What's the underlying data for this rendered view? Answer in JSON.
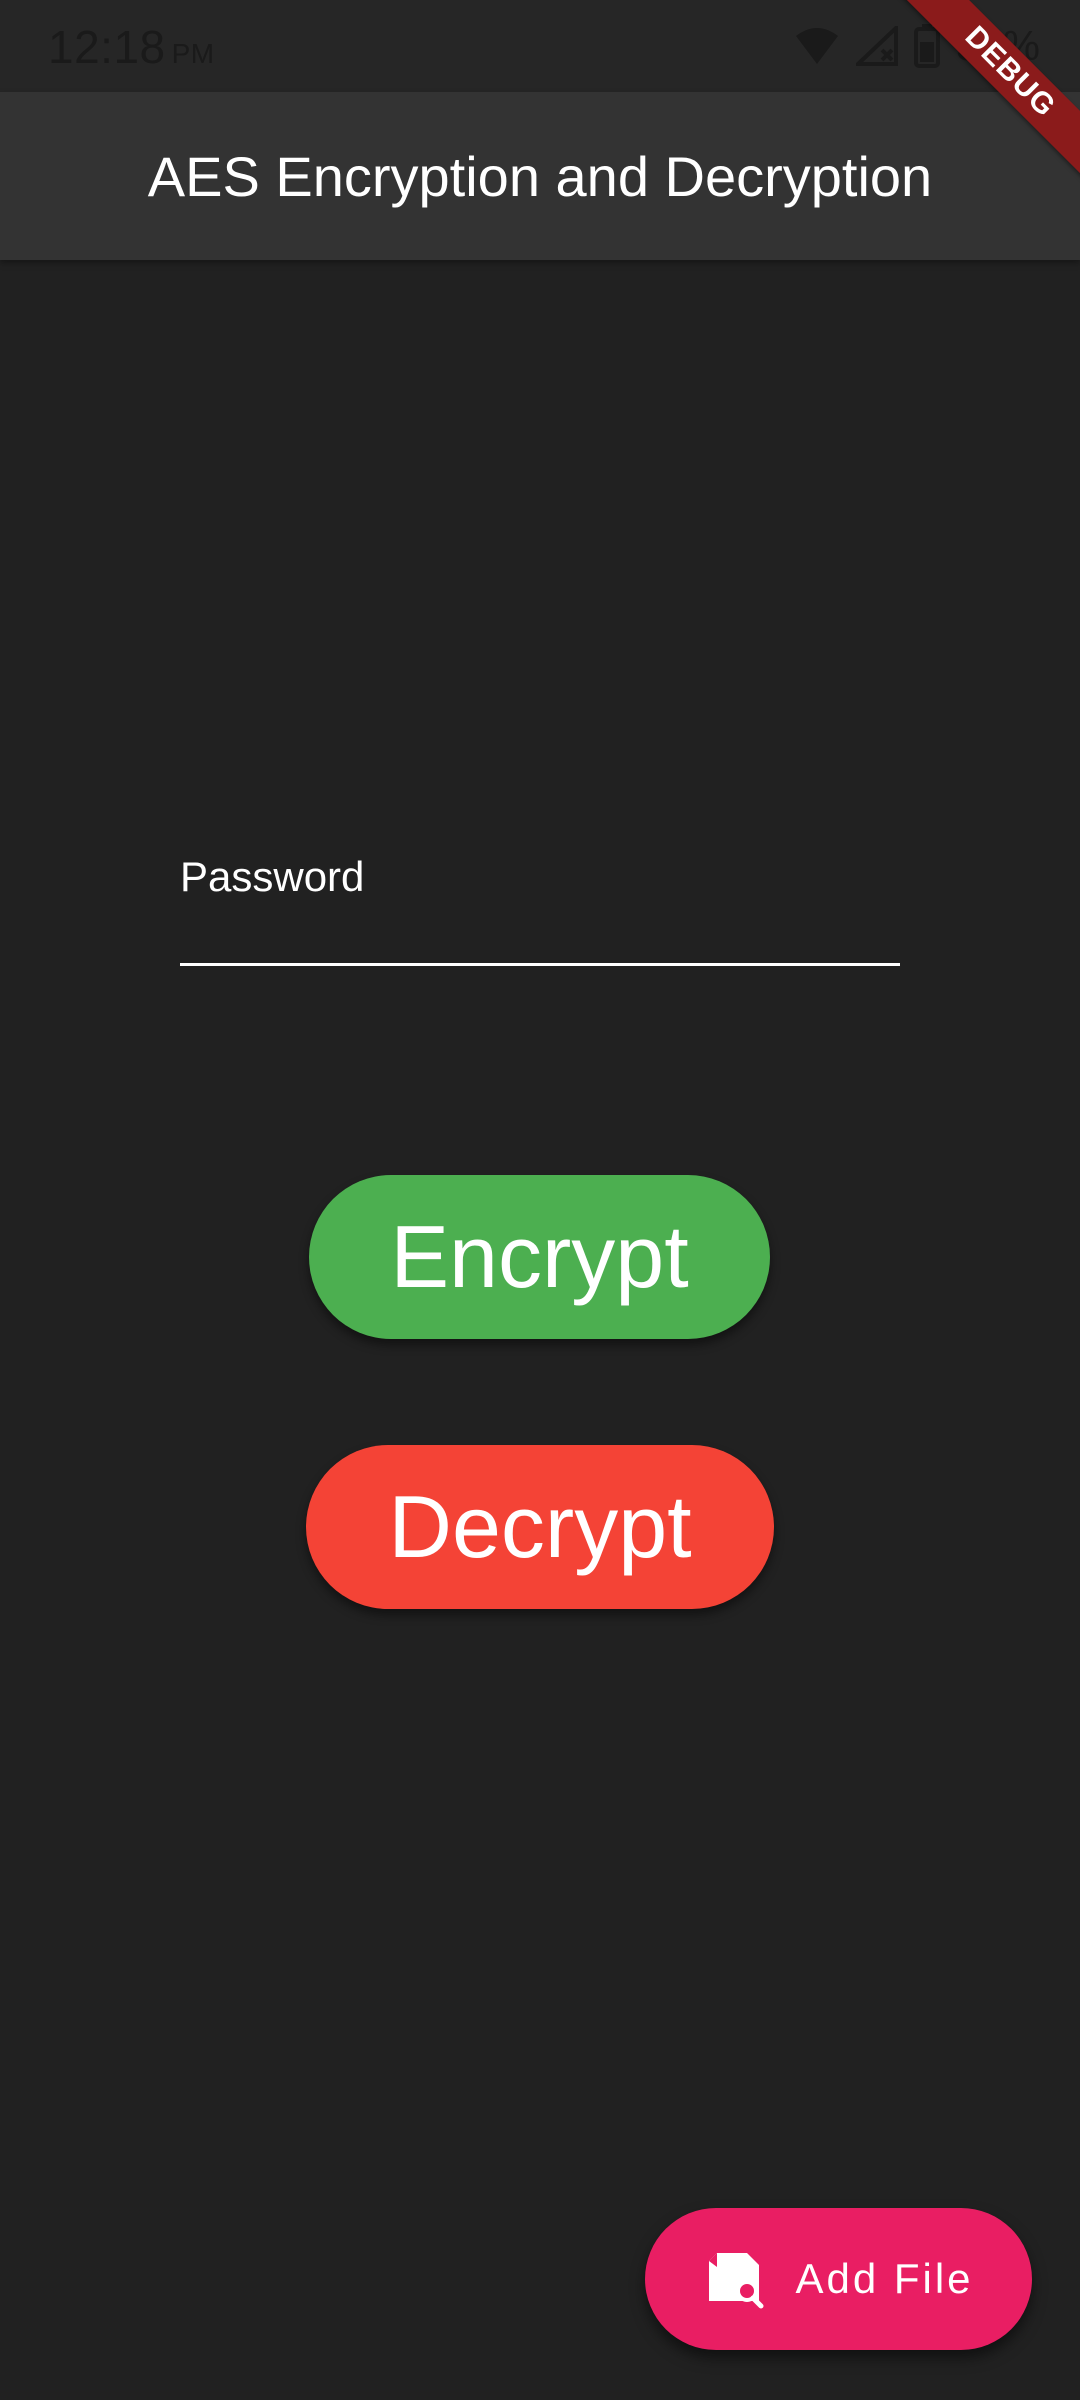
{
  "status_bar": {
    "time": "12:18",
    "ampm": "PM",
    "battery_text": "3_%"
  },
  "debug_banner": {
    "label": "DEBUG"
  },
  "app_bar": {
    "title": "AES Encryption and Decryption"
  },
  "password_field": {
    "label": "Password",
    "value": "",
    "placeholder": ""
  },
  "buttons": {
    "encrypt_label": "Encrypt",
    "decrypt_label": "Decrypt"
  },
  "fab": {
    "label": "Add File",
    "icon": "file-search-icon"
  },
  "colors": {
    "background": "#212121",
    "app_bar": "#333333",
    "encrypt": "#4caf50",
    "decrypt": "#f44336",
    "fab": "#e91e63",
    "debug_banner": "#8b1b1b"
  },
  "icons": {
    "status": [
      "wifi-icon",
      "cellular-no-signal-icon",
      "battery-icon"
    ]
  }
}
